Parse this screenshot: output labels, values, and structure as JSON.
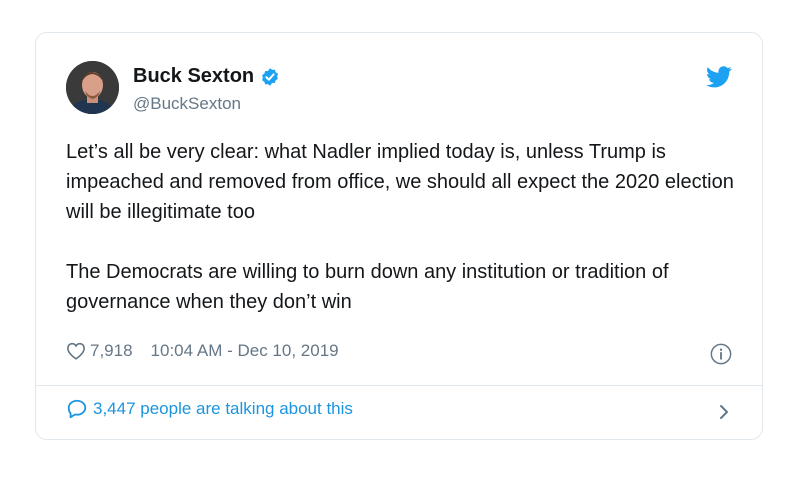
{
  "tweet": {
    "author_name": "Buck Sexton",
    "author_handle": "@BuckSexton",
    "paragraphs": [
      "Let’s all be very clear: what Nadler implied today is, unless Trump is impeached and removed from office, we should all expect the 2020 election will be illegitimate too",
      "The Democrats are willing to burn down any institution or tradition of governance when they don’t win"
    ],
    "likes": "7,918",
    "timestamp": "10:04 AM - Dec 10, 2019",
    "talking_label": "3,447 people are talking about this"
  },
  "icons": {
    "avatar": "profile-photo",
    "verified": "verified-badge-icon",
    "brand": "twitter-bird-icon",
    "like": "heart-icon",
    "info": "info-icon",
    "reply": "speech-bubble-icon",
    "more": "chevron-right-icon"
  },
  "colors": {
    "brand_blue": "#1da1f2",
    "link_blue": "#1b95e0",
    "secondary_text": "#657786",
    "border": "#e1e8ed"
  }
}
